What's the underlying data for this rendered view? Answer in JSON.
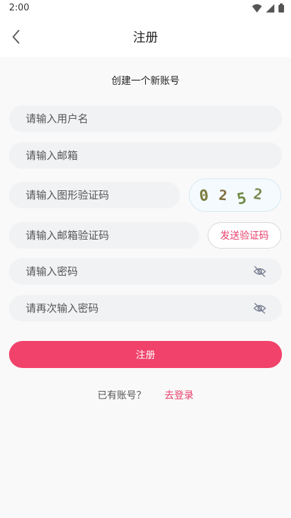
{
  "status_bar": {
    "time": "2:00"
  },
  "app_bar": {
    "title": "注册"
  },
  "form": {
    "subtitle": "创建一个新账号",
    "username": {
      "placeholder": "请输入用户名"
    },
    "email": {
      "placeholder": "请输入邮箱"
    },
    "captcha": {
      "placeholder": "请输入图形验证码",
      "image_text": "0252"
    },
    "email_code": {
      "placeholder": "请输入邮箱验证码",
      "send_label": "发送验证码"
    },
    "password": {
      "placeholder": "请输入密码"
    },
    "confirm_password": {
      "placeholder": "请再次输入密码"
    },
    "submit_label": "注册"
  },
  "footer": {
    "prompt": "已有账号？",
    "login_link": "去登录"
  },
  "colors": {
    "accent": "#f1426b",
    "link": "#e83e6b",
    "field_bg": "#f1f2f4",
    "page_bg": "#f9f9f9"
  },
  "icons": {
    "back": "chevron-left-icon",
    "eye_off": "eye-off-icon",
    "wifi": "wifi-icon",
    "signal": "signal-icon",
    "battery": "battery-icon"
  }
}
